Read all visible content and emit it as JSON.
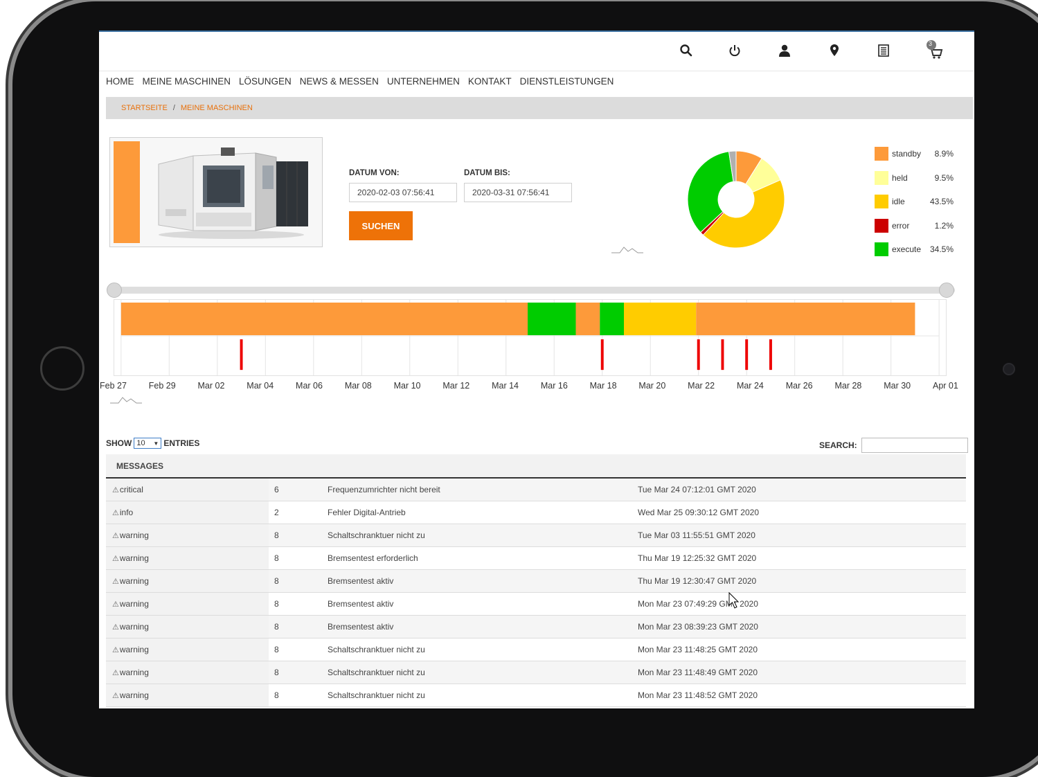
{
  "header": {
    "icons": [
      "search-icon",
      "power-icon",
      "user-icon",
      "location-pin-icon",
      "document-list-icon",
      "cart-icon"
    ],
    "cart_count": "3"
  },
  "nav": {
    "items": [
      "HOME",
      "MEINE MASCHINEN",
      "LÖSUNGEN",
      "NEWS & MESSEN",
      "UNTERNEHMEN",
      "KONTAKT",
      "DIENSTLEISTUNGEN"
    ]
  },
  "breadcrumb": {
    "home": "STARTSEITE",
    "separator": "/",
    "current": "MEINE MASCHINEN"
  },
  "form": {
    "from_label": "DATUM VON:",
    "from_value": "2020-02-03 07:56:41",
    "to_label": "DATUM BIS:",
    "to_value": "2020-03-31 07:56:41",
    "search_button": "SUCHEN"
  },
  "colors": {
    "standby": "#fd9a3a",
    "held": "#ffff99",
    "idle": "#ffcc00",
    "error": "#cc0000",
    "execute": "#00cc00",
    "other": "#b0b0b0",
    "accent": "#ee7208"
  },
  "chart_data": [
    {
      "type": "pie",
      "title": "",
      "series": [
        {
          "name": "standby",
          "value": 8.9,
          "label": "8.9%"
        },
        {
          "name": "held",
          "value": 9.5,
          "label": "9.5%"
        },
        {
          "name": "idle",
          "value": 43.5,
          "label": "43.5%"
        },
        {
          "name": "error",
          "value": 1.2,
          "label": "1.2%"
        },
        {
          "name": "execute",
          "value": 34.5,
          "label": "34.5%"
        }
      ],
      "legend": "right"
    },
    {
      "type": "bar",
      "title": "",
      "x_range": [
        "2020-02-27",
        "2020-04-01"
      ],
      "tick_labels": [
        "Feb 27",
        "Feb 29",
        "Mar 02",
        "Mar 04",
        "Mar 06",
        "Mar 08",
        "Mar 10",
        "Mar 12",
        "Mar 14",
        "Mar 16",
        "Mar 18",
        "Mar 20",
        "Mar 22",
        "Mar 24",
        "Mar 26",
        "Mar 28",
        "Mar 30",
        "Apr 01"
      ],
      "state_segments": [
        {
          "state": "standby",
          "start": 0,
          "end": 16.9
        },
        {
          "state": "execute",
          "start": 16.9,
          "end": 18.9
        },
        {
          "state": "standby",
          "start": 18.9,
          "end": 19.9
        },
        {
          "state": "execute",
          "start": 19.9,
          "end": 20.9
        },
        {
          "state": "idle",
          "start": 20.9,
          "end": 23.9
        },
        {
          "state": "standby",
          "start": 23.9,
          "end": 33.0
        }
      ],
      "error_markers": [
        5.0,
        20.0,
        24.0,
        25.0,
        26.0,
        27.0
      ],
      "grid": true
    }
  ],
  "table": {
    "show_label": "SHOW",
    "entries_value": "10",
    "entries_label": "ENTRIES",
    "search_label": "SEARCH:",
    "column_header": "MESSAGES",
    "rows": [
      {
        "level": "critical",
        "code": "6",
        "message": "Frequenzumrichter nicht bereit",
        "time": "Tue Mar 24 07:12:01 GMT 2020"
      },
      {
        "level": "info",
        "code": "2",
        "message": "Fehler Digital-Antrieb",
        "time": "Wed Mar 25 09:30:12 GMT 2020"
      },
      {
        "level": "warning",
        "code": "8",
        "message": "Schaltschranktuer nicht zu",
        "time": "Tue Mar 03 11:55:51 GMT 2020"
      },
      {
        "level": "warning",
        "code": "8",
        "message": "Bremsentest erforderlich",
        "time": "Thu Mar 19 12:25:32 GMT 2020"
      },
      {
        "level": "warning",
        "code": "8",
        "message": "Bremsentest aktiv",
        "time": "Thu Mar 19 12:30:47 GMT 2020"
      },
      {
        "level": "warning",
        "code": "8",
        "message": "Bremsentest aktiv",
        "time": "Mon Mar 23 07:49:29 GMT 2020"
      },
      {
        "level": "warning",
        "code": "8",
        "message": "Bremsentest aktiv",
        "time": "Mon Mar 23 08:39:23 GMT 2020"
      },
      {
        "level": "warning",
        "code": "8",
        "message": "Schaltschranktuer nicht zu",
        "time": "Mon Mar 23 11:48:25 GMT 2020"
      },
      {
        "level": "warning",
        "code": "8",
        "message": "Schaltschranktuer nicht zu",
        "time": "Mon Mar 23 11:48:49 GMT 2020"
      },
      {
        "level": "warning",
        "code": "8",
        "message": "Schaltschranktuer nicht zu",
        "time": "Mon Mar 23 11:48:52 GMT 2020"
      }
    ]
  }
}
